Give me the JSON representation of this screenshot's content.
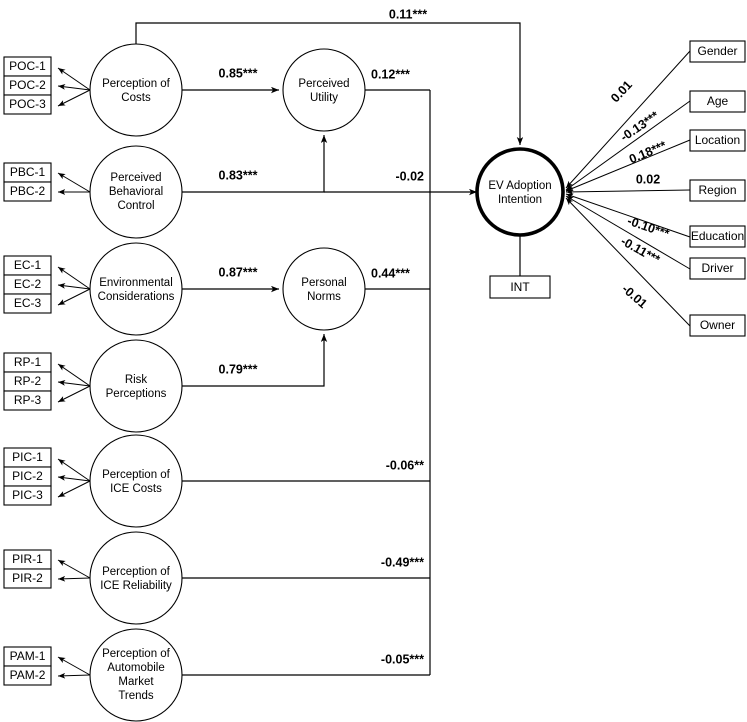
{
  "diagram": {
    "type": "structural-equation-model",
    "title": "",
    "outcome_node": {
      "id": "ev-adoption-intention",
      "label_line1": "EV Adoption",
      "label_line2": "Intention",
      "indicator": "INT"
    },
    "latent_constructs": [
      {
        "id": "perception-of-costs",
        "label_line1": "Perception of",
        "label_line2": "Costs",
        "label_line3": "",
        "label_line4": "",
        "indicators": [
          "POC-1",
          "POC-2",
          "POC-3"
        ]
      },
      {
        "id": "perceived-behavioral-control",
        "label_line1": "Perceived",
        "label_line2": "Behavioral",
        "label_line3": "Control",
        "label_line4": "",
        "indicators": [
          "PBC-1",
          "PBC-2"
        ]
      },
      {
        "id": "environmental-considerations",
        "label_line1": "Environmental",
        "label_line2": "Considerations",
        "label_line3": "",
        "label_line4": "",
        "indicators": [
          "EC-1",
          "EC-2",
          "EC-3"
        ]
      },
      {
        "id": "risk-perceptions",
        "label_line1": "Risk",
        "label_line2": "Perceptions",
        "label_line3": "",
        "label_line4": "",
        "indicators": [
          "RP-1",
          "RP-2",
          "RP-3"
        ]
      },
      {
        "id": "perception-of-ice-costs",
        "label_line1": "Perception of",
        "label_line2": "ICE Costs",
        "label_line3": "",
        "label_line4": "",
        "indicators": [
          "PIC-1",
          "PIC-2",
          "PIC-3"
        ]
      },
      {
        "id": "perception-of-ice-reliability",
        "label_line1": "Perception of",
        "label_line2": "ICE Reliability",
        "label_line3": "",
        "label_line4": "",
        "indicators": [
          "PIR-1",
          "PIR-2"
        ]
      },
      {
        "id": "perception-of-automobile-market-trends",
        "label_line1": "Perception of",
        "label_line2": "Automobile",
        "label_line3": "Market",
        "label_line4": "Trends",
        "indicators": [
          "PAM-1",
          "PAM-2"
        ]
      }
    ],
    "mediator_constructs": [
      {
        "id": "perceived-utility",
        "label_line1": "Perceived",
        "label_line2": "Utility"
      },
      {
        "id": "personal-norms",
        "label_line1": "Personal",
        "label_line2": "Norms"
      }
    ],
    "demographic_boxes": [
      {
        "id": "gender",
        "label": "Gender"
      },
      {
        "id": "age",
        "label": "Age"
      },
      {
        "id": "location",
        "label": "Location"
      },
      {
        "id": "region",
        "label": "Region"
      },
      {
        "id": "education",
        "label": "Education"
      },
      {
        "id": "driver",
        "label": "Driver"
      },
      {
        "id": "owner",
        "label": "Owner"
      }
    ],
    "path_coefficients": {
      "poc_to_perceived_utility": "0.85***",
      "pbc_to_ev_adoption": "0.83***",
      "ec_to_personal_norms": "0.87***",
      "rp_to_personal_norms": "0.79***",
      "poc_to_ev_adoption_direct": "0.11***",
      "perceived_utility_to_ev": "0.12***",
      "pbc_path_to_ev": "-0.02",
      "personal_norms_to_ev": "0.44***",
      "pic_to_ev": "-0.06**",
      "pir_to_ev": "-0.49***",
      "pam_to_ev": "-0.05***",
      "gender_to_ev": "0.01",
      "age_to_ev": "-0.13***",
      "location_to_ev": "0.18***",
      "region_to_ev": "0.02",
      "education_to_ev": "-0.10***",
      "driver_to_ev": "-0.11***",
      "owner_to_ev": "-0.01"
    },
    "colors": {
      "stroke": "#000000",
      "fill": "#ffffff"
    }
  }
}
